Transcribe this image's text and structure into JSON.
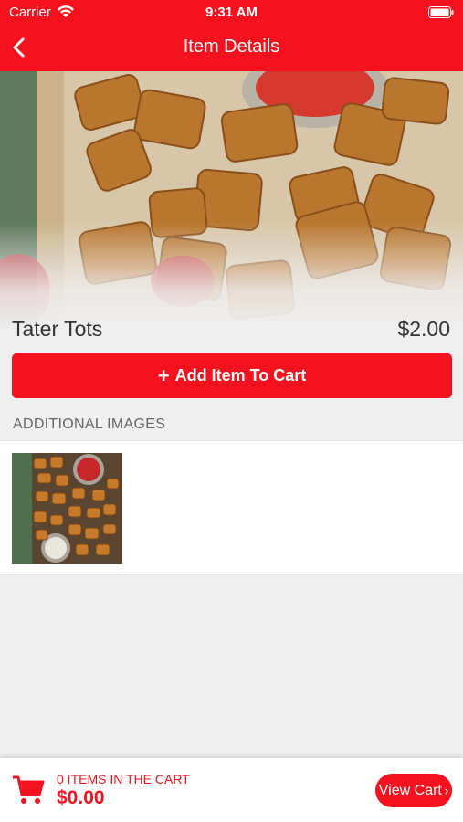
{
  "status_bar": {
    "carrier": "Carrier",
    "time": "9:31 AM"
  },
  "nav": {
    "title": "Item Details",
    "back_icon": "chevron-left-icon"
  },
  "item": {
    "name": "Tater Tots",
    "price": "$2.00"
  },
  "actions": {
    "add_to_cart_label": "Add Item To Cart",
    "add_icon": "plus-icon"
  },
  "additional_images": {
    "header": "ADDITIONAL IMAGES",
    "count": 1
  },
  "cart": {
    "items_label": "0 ITEMS IN THE CART",
    "total": "$0.00",
    "view_cart_label": "View Cart",
    "view_cart_icon": "chevron-right-icon",
    "cart_icon": "shopping-cart-icon"
  },
  "colors": {
    "brand_red": "#f5121f",
    "background": "#efefef",
    "text_dark": "#333333",
    "text_muted": "#666666"
  }
}
